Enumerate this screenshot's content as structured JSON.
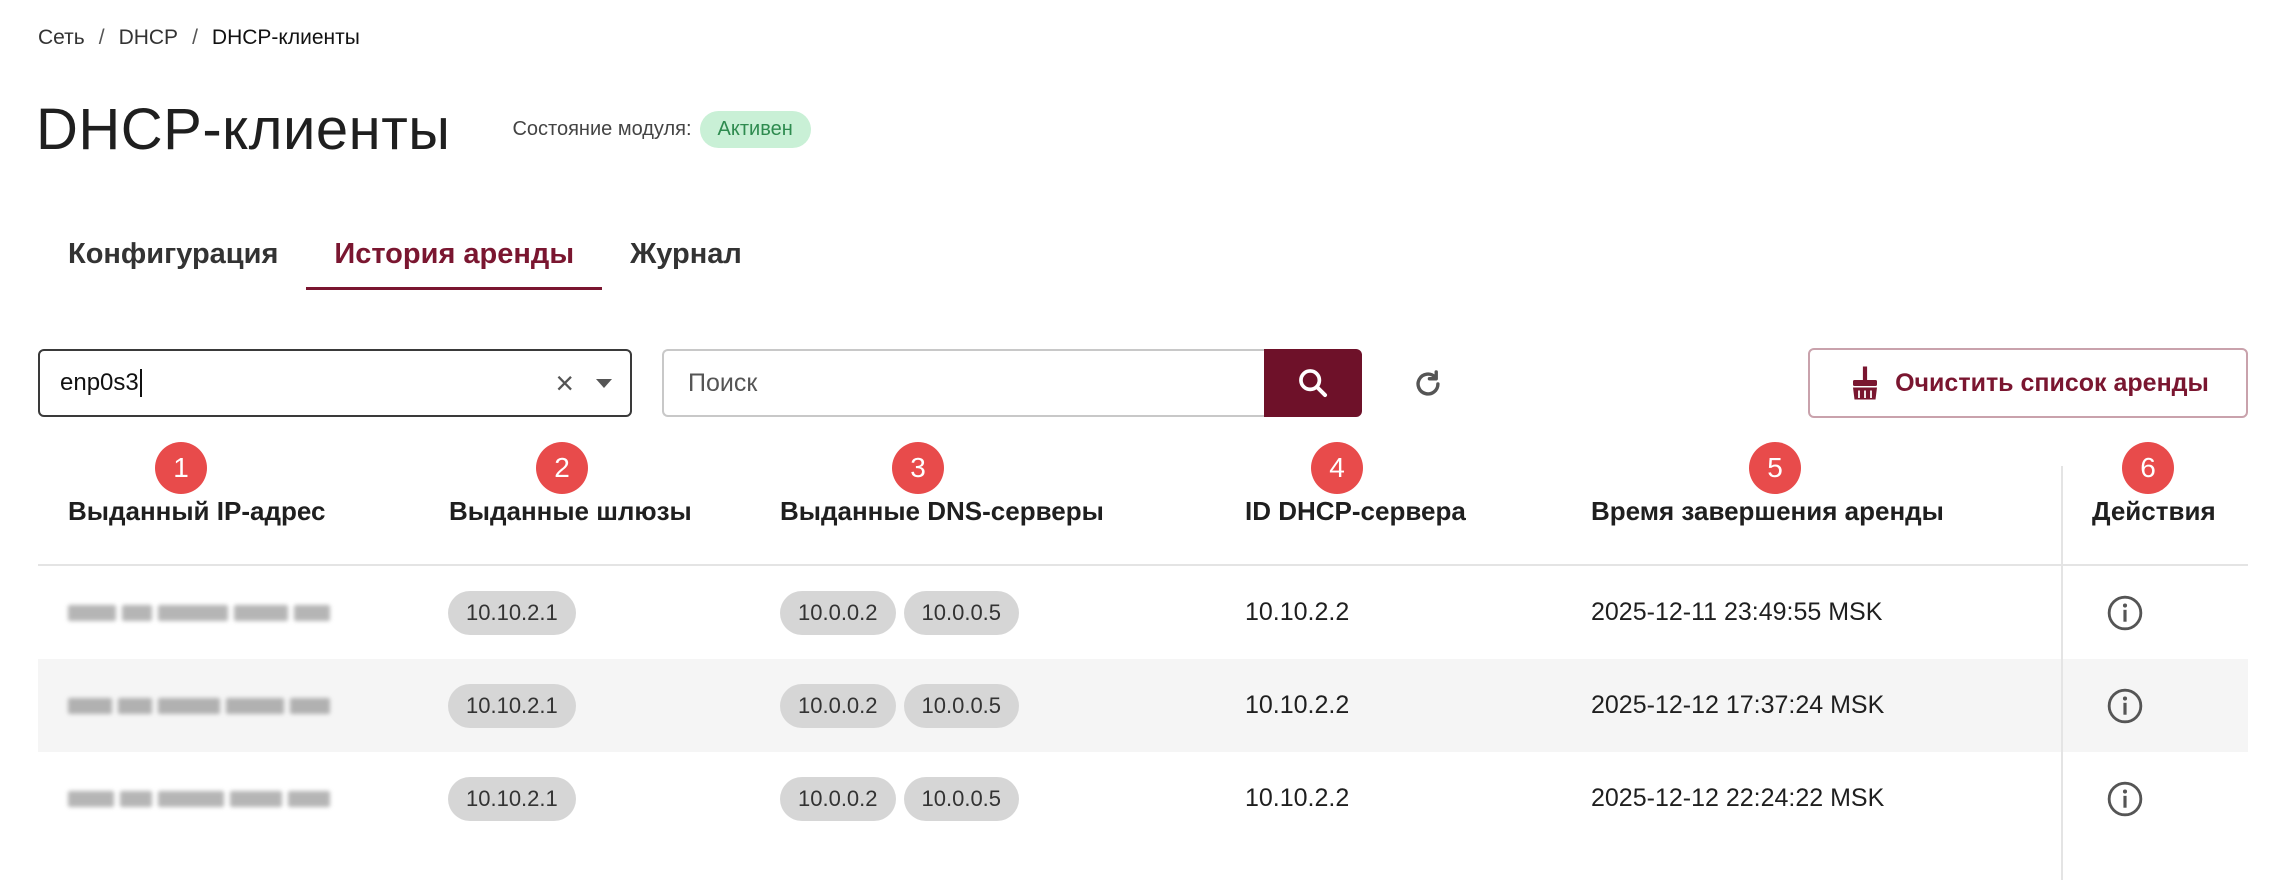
{
  "breadcrumb": {
    "items": [
      "Сеть",
      "DHCP",
      "DHCP-клиенты"
    ],
    "separator": "/"
  },
  "page": {
    "title": "DHCP-клиенты",
    "status_label": "Состояние модуля:",
    "status_value": "Активен",
    "status_color": "#2e8b4f"
  },
  "tabs": [
    {
      "label": "Конфигурация",
      "active": false
    },
    {
      "label": "История аренды",
      "active": true
    },
    {
      "label": "Журнал",
      "active": false
    }
  ],
  "filters": {
    "interface_value": "enp0s3",
    "search_placeholder": "Поиск",
    "search_value": ""
  },
  "actions": {
    "clear_lease_label": "Очистить список аренды"
  },
  "markers": [
    "1",
    "2",
    "3",
    "4",
    "5",
    "6"
  ],
  "table": {
    "columns": [
      "Выданный IP-адрес",
      "Выданные шлюзы",
      "Выданные DNS-серверы",
      "ID DHCP-сервера",
      "Время завершения аренды",
      "Действия"
    ],
    "rows": [
      {
        "gateway": "10.10.2.1",
        "dns": [
          "10.0.0.2",
          "10.0.0.5"
        ],
        "server_id": "10.10.2.2",
        "lease_end": "2025-12-11 23:49:55 MSK"
      },
      {
        "gateway": "10.10.2.1",
        "dns": [
          "10.0.0.2",
          "10.0.0.5"
        ],
        "server_id": "10.10.2.2",
        "lease_end": "2025-12-12 17:37:24 MSK"
      },
      {
        "gateway": "10.10.2.1",
        "dns": [
          "10.0.0.2",
          "10.0.0.5"
        ],
        "server_id": "10.10.2.2",
        "lease_end": "2025-12-12 22:24:22 MSK"
      }
    ]
  },
  "colors": {
    "accent": "#7a1630",
    "marker": "#e84b4b",
    "badge_bg": "#c9f0d6"
  }
}
